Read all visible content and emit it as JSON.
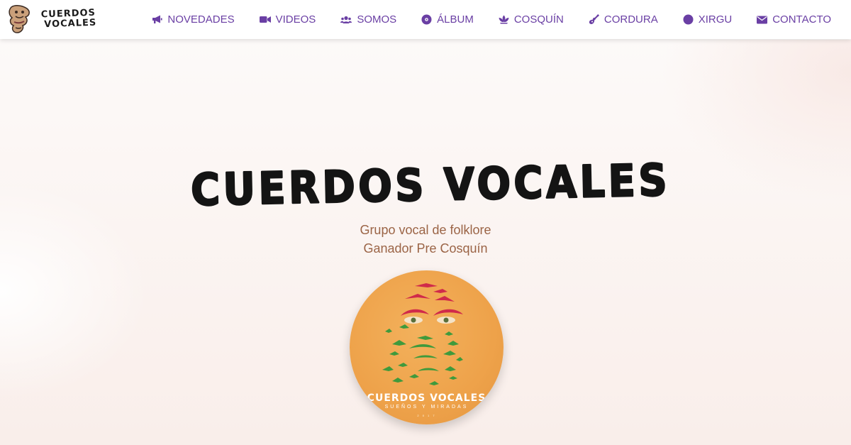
{
  "nav": {
    "brand_line1": "CUERDOS",
    "brand_line2": "VOCALES",
    "items": [
      {
        "label": "NOVEDADES",
        "icon": "megaphone-icon"
      },
      {
        "label": "VIDEOS",
        "icon": "video-camera-icon"
      },
      {
        "label": "SOMOS",
        "icon": "users-icon"
      },
      {
        "label": "ÁLBUM",
        "icon": "compact-disc-icon"
      },
      {
        "label": "COSQUÍN",
        "icon": "lotus-icon"
      },
      {
        "label": "CORDURA",
        "icon": "guitar-icon"
      },
      {
        "label": "XIRGU",
        "icon": "circle-icon"
      },
      {
        "label": "CONTACTO",
        "icon": "envelope-icon"
      }
    ]
  },
  "hero": {
    "title": "CUERDOS VOCALES",
    "subtitle_line1": "Grupo vocal de folklore",
    "subtitle_line2": "Ganador Pre Cosquín"
  },
  "album": {
    "title": "CUERDOS VOCALES",
    "subtitle": "SUEÑOS Y MIRADAS",
    "tiny": "2 0 1 7"
  },
  "colors": {
    "nav_text": "#6a3fa4",
    "subtitle_text": "#9b6446",
    "album_bg": "#eea24a",
    "bird_red": "#d02a4a",
    "bird_green": "#3f9a3c"
  }
}
